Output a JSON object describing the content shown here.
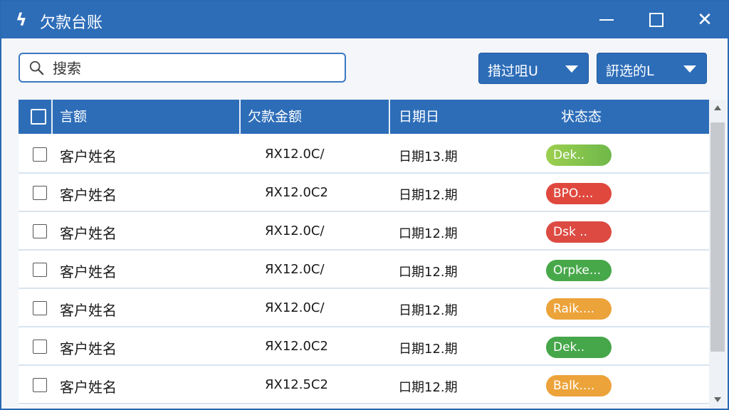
{
  "window": {
    "title": "欠款台账",
    "app_icon": "ledger-app-icon"
  },
  "search": {
    "placeholder": "搜索"
  },
  "filters": [
    {
      "label": "措过咀U"
    },
    {
      "label": "詽选的L"
    }
  ],
  "table": {
    "headers": [
      "言额",
      "欠款金额",
      "日期日",
      "状态态"
    ],
    "rows": [
      {
        "name": "客户姓名",
        "amount": "ЯX12.0C/",
        "date": "日期13.期",
        "status": "Dek..",
        "status_color": "#6fb84a",
        "status_color2": "#9ccf4f"
      },
      {
        "name": "客户姓名",
        "amount": "ЯX12.0C2",
        "date": "日期12.期",
        "status": "BPO....",
        "status_color": "#e0483e",
        "status_color2": "#e0483e"
      },
      {
        "name": "客户姓名",
        "amount": "ЯX12.0C/",
        "date": "口期12.期",
        "status": "Dsk ..",
        "status_color": "#dc4a42",
        "status_color2": "#dc4a42"
      },
      {
        "name": "客户姓名",
        "amount": "ЯX12.0C/",
        "date": "口期12.期",
        "status": "Orpke...",
        "status_color": "#47a84a",
        "status_color2": "#47a84a"
      },
      {
        "name": "客户姓名",
        "amount": "ЯX12.0C/",
        "date": "日期12.期",
        "status": "Raik....",
        "status_color": "#eca33a",
        "status_color2": "#eca33a"
      },
      {
        "name": "客户姓名",
        "amount": "ЯX12.0C2",
        "date": "日期12.期",
        "status": "Dek..",
        "status_color": "#45a64a",
        "status_color2": "#45a64a"
      },
      {
        "name": "客户姓名",
        "amount": "ЯX12.5C2",
        "date": "口期12.期",
        "status": "Balk....",
        "status_color": "#eca33a",
        "status_color2": "#eca33a"
      }
    ]
  },
  "colors": {
    "accent": "#2d6db8",
    "row_border": "#d8e4f0"
  }
}
